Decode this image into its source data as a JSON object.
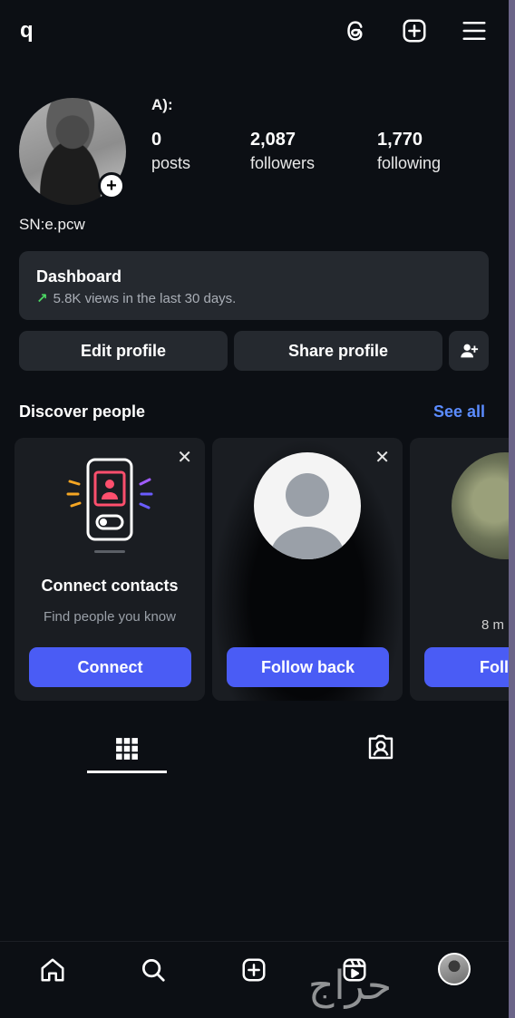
{
  "header": {
    "username": "q",
    "display_name": "A):"
  },
  "stats": [
    {
      "value": "0",
      "label": "posts"
    },
    {
      "value": "2,087",
      "label": "followers"
    },
    {
      "value": "1,770",
      "label": "following"
    }
  ],
  "bio": "SN:e.pcw",
  "dashboard": {
    "title": "Dashboard",
    "arrow": "↗",
    "subtitle": "5.8K views in the last 30 days."
  },
  "actions": {
    "edit_label": "Edit profile",
    "share_label": "Share profile"
  },
  "discover": {
    "title": "Discover people",
    "see_all": "See all",
    "cards": [
      {
        "title": "Connect contacts",
        "subtitle": "Find people you know",
        "button": "Connect"
      },
      {
        "button": "Follow back"
      },
      {
        "meta": "8 m",
        "button": "Follow"
      }
    ]
  },
  "watermark": "حراج",
  "colors": {
    "background": "#0c0f14",
    "surface": "#25292f",
    "accent": "#4a5cf5",
    "link": "#5b8cff",
    "trend": "#4cd964"
  },
  "icons": {
    "top": [
      "threads-icon",
      "create-post-icon",
      "menu-icon"
    ],
    "tabs": [
      "grid-icon",
      "tagged-icon"
    ],
    "nav": [
      "home-icon",
      "search-icon",
      "create-icon",
      "reels-icon",
      "profile-avatar"
    ]
  }
}
